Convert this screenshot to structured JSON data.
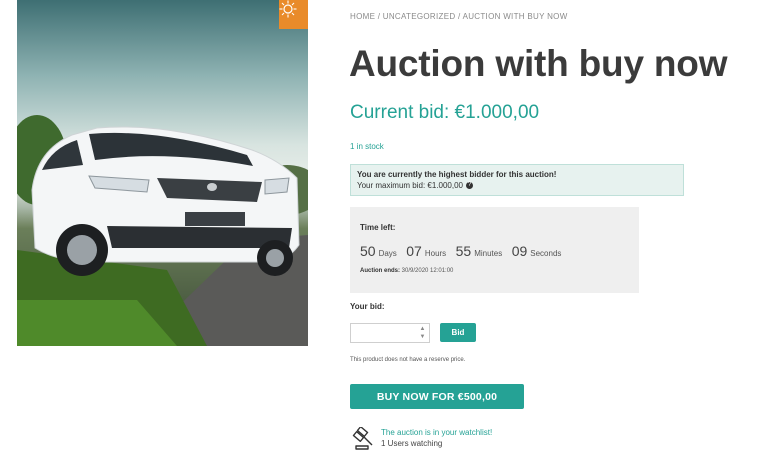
{
  "breadcrumb": {
    "home": "Home",
    "sep1": " / ",
    "category": "Uncategorized",
    "sep2": " / ",
    "current": "Auction with buy now"
  },
  "product": {
    "title": "Auction with buy now",
    "current_bid": "Current bid: €1.000,00",
    "stock": "1 in stock"
  },
  "notice": {
    "headline": "You are currently the highest bidder for this auction!",
    "max_bid": "Your maximum bid: €1.000,00"
  },
  "timer": {
    "label": "Time left:",
    "days": "50",
    "days_unit": "Days",
    "hours": "07",
    "hours_unit": "Hours",
    "minutes": "55",
    "minutes_unit": "Minutes",
    "seconds": "09",
    "seconds_unit": "Seconds",
    "ends_label": "Auction ends:",
    "ends_value": "30/9/2020 12:01:00"
  },
  "bid_form": {
    "label": "Your bid:",
    "input_value": "",
    "button": "Bid",
    "reserve_note": "This product does not have a reserve price."
  },
  "buy_now": {
    "label": "BUY NOW FOR €500,00"
  },
  "watchlist": {
    "message": "The auction is in your watchlist!",
    "count": "1 Users watching"
  },
  "colors": {
    "accent": "#25a295",
    "badge": "#e98b2a",
    "notice_bg": "#e7f2ef"
  },
  "icons": {
    "zoom": "sun-zoom-icon",
    "watch": "gavel-icon",
    "help": "question-icon"
  }
}
